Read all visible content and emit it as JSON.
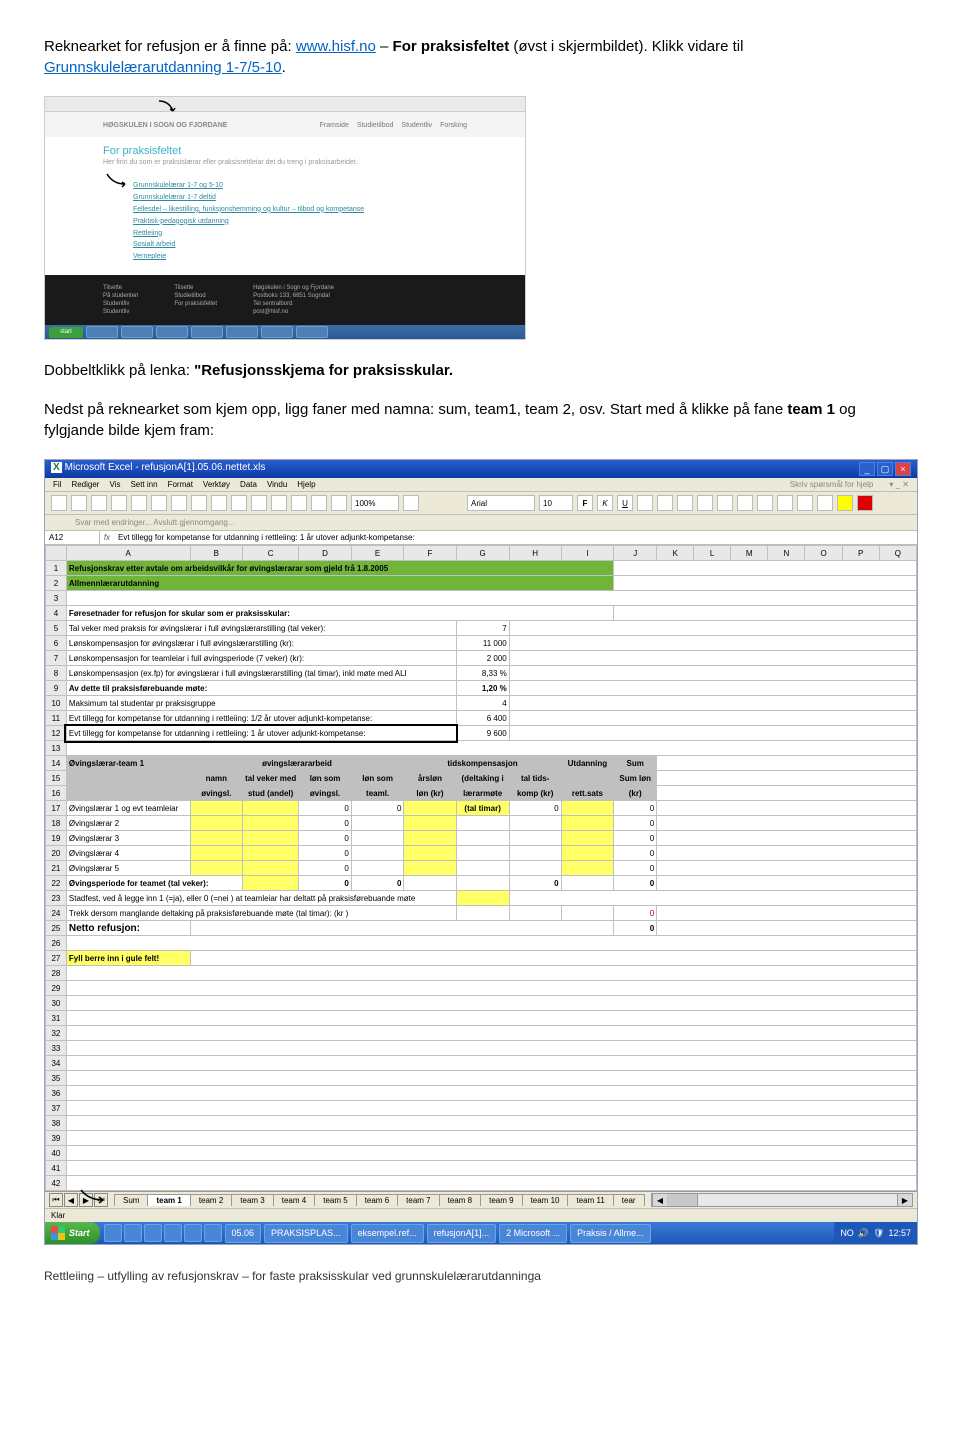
{
  "para1_prefix": "Reknearket for refusjon er å finne på: ",
  "link1": "www.hisf.no",
  "para1_mid": " – ",
  "bold1": "For praksisfeltet",
  "para1_tail": " (øvst i skjermbildet). Klikk vidare til ",
  "link2": "Grunnskulelærarutdanning 1-7/5-10",
  "dot": ".",
  "para2_prefix": "Dobbeltklikk på lenka: ",
  "bold2": "\"Refusjonsskjema for praksisskular.",
  "para3": "Nedst på reknearket som kjem opp, ligg faner med namna: sum, team1, team 2, osv. Start med å klikke på fane ",
  "bold3": "team 1",
  "para3_tail": " og fylgjande bilde kjem fram:",
  "webshot": {
    "nav": [
      "Framside",
      "Studietilbod",
      "Studentliv",
      "Forsking"
    ],
    "title": "For praksisfeltet",
    "subtitle": "Her finn du som er praksislærar eller praksisrettleiar det du treng i praksisarbeidet.",
    "links": [
      "Grunnskulelærar 1-7 og 5-10",
      "Grunnskulelærar 1-7 deltid",
      "Fellesdel – likestilling, funksjonshemming og kultur – tilbod og kompetanse",
      "Praktisk-pedagogisk utdanning",
      "Rettleiing",
      "Sosialt arbeid",
      "Vernepleie"
    ],
    "footer_cols": [
      [
        "Tilsette",
        "På studenten",
        "Studentliv",
        "Studentliv"
      ],
      [
        "Tilsette",
        "Studietilbod",
        "For praksisfeltet"
      ],
      [
        "Høgskulen i Sogn og Fjordane",
        "Postboks 133, 6851 Sogndal",
        "Tel sentralbord",
        "post@hisf.no"
      ]
    ]
  },
  "excel": {
    "title": "Microsoft Excel - refusjonA[1].05.06.nettet.xls",
    "searchhelp": "Skriv spørsmål for hjelp",
    "menus": [
      "Fil",
      "Rediger",
      "Vis",
      "Sett inn",
      "Format",
      "Verktøy",
      "Data",
      "Vindu",
      "Hjelp"
    ],
    "zoom": "100%",
    "font": "Arial",
    "fontsize": "10",
    "revtext": "Svar med endringer...  Avslutt gjennomgang...",
    "namebox": "A12",
    "formula": "Evt tillegg for kompetanse for utdanning i rettleiing: 1 år utover adjunkt-kompetanse:",
    "cols": [
      "A",
      "B",
      "C",
      "D",
      "E",
      "F",
      "G",
      "H",
      "I",
      "J",
      "K",
      "L",
      "M",
      "N",
      "O",
      "P",
      "Q"
    ],
    "row1": "Refusjonskrav etter avtale om arbeidsvilkår for øvingslærarar som gjeld frå 1.8.2005",
    "row2": "Allmennlærarutdanning",
    "row4": "Føresetnader for refusjon for skular som er praksisskular:",
    "row5": [
      "Tal veker med praksis for øvingslærar i full øvingslærarstilling (tal veker):",
      "7"
    ],
    "row6": [
      "Lønskompensasjon for øvingslærar i full øvingslærarstilling (kr):",
      "11 000"
    ],
    "row7": [
      "Lønskompensasjon for teamleiar i full øvingsperiode (7 veker) (kr):",
      "2 000"
    ],
    "row8": [
      "Lønskompensasjon (ex.fp) for øvingslærar i full øvingslærarstilling (tal timar), inkl møte med ALI",
      "8,33 %"
    ],
    "row9": [
      "        Av dette til praksisførebuande møte:",
      "1,20 %"
    ],
    "row10": [
      "Maksimum tal studentar pr praksisgruppe",
      "4"
    ],
    "row11": [
      "Evt tillegg for kompetanse for utdanning i rettleiing: 1/2 år utover adjunkt-kompetanse:",
      "6 400"
    ],
    "row12": [
      "Evt tillegg for kompetanse for utdanning i rettleiing: 1 år utover adjunkt-kompetanse:",
      "9 600"
    ],
    "hdr14_team": "Øvingslærar-team 1",
    "hdr14_ov": "øvingslærararbeid",
    "hdr14_td": "tidskompensasjon",
    "hdr14_ut": "Utdanning",
    "hdr14_sum": "Sum",
    "hdr15": [
      "namn",
      "tal veker med",
      "løn som",
      "løn som",
      "årsløn",
      "(deltaking i",
      "tal tids-",
      "Sum løn"
    ],
    "hdr16": [
      "øvingsl.",
      "stud (andel)",
      "øvingsl.",
      "teaml.",
      "løn (kr)",
      "lærarmøte",
      "komp (kr)",
      "rett.sats",
      "(kr)"
    ],
    "rows1721": [
      "Øvingslærar 1 og evt teamleiar",
      "Øvingslærar 2",
      "Øvingslærar 3",
      "Øvingslærar 4",
      "Øvingslærar 5"
    ],
    "row22": "Øvingsperiode for teamet (tal veker):",
    "row23": "Stadfest, ved å legge inn 1 (=ja), eller 0 (=nei ) at teamleiar har deltatt på praksisførebuande møte",
    "row24": "Trekk dersom manglande deltaking på praksisførebuande møte (tal timar): (kr )",
    "row25": "Netto refusjon:",
    "row27": "Fyll berre inn i gule felt!",
    "tabs": [
      "Sum",
      "team 1",
      "team 2",
      "team 3",
      "team 4",
      "team 5",
      "team 6",
      "team 7",
      "team 8",
      "team 9",
      "team 10",
      "team 11",
      "tear"
    ],
    "status": "Klar",
    "taskbuttons": [
      "05.06",
      "PRAKSISPLAS...",
      "eksempel.ref...",
      "refusjonA[1]...",
      "2 Microsoft ...",
      "Praksis / Allme..."
    ],
    "tray": "NO",
    "clock": "12:57"
  },
  "footer": "Rettleiing – utfylling av refusjonskrav – for faste praksisskular ved grunnskulelærarutdanninga"
}
